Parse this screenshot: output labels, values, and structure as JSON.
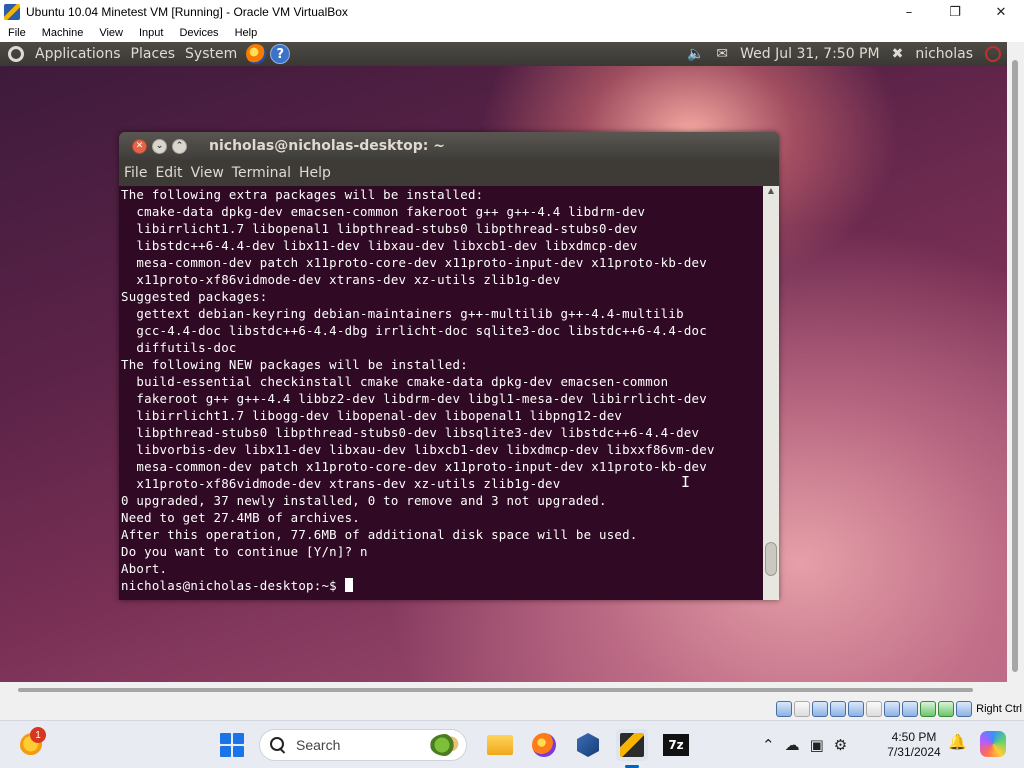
{
  "vbox": {
    "title": "Ubuntu 10.04 Minetest VM [Running] - Oracle VM VirtualBox",
    "menu": [
      "File",
      "Machine",
      "View",
      "Input",
      "Devices",
      "Help"
    ],
    "host_key": "Right Ctrl"
  },
  "ubuntu_panel": {
    "menus": [
      "Applications",
      "Places",
      "System"
    ],
    "datetime": "Wed Jul 31,  7:50 PM",
    "user": "nicholas"
  },
  "terminal": {
    "title": "nicholas@nicholas-desktop: ~",
    "menu": [
      "File",
      "Edit",
      "View",
      "Terminal",
      "Help"
    ],
    "lines": [
      "The following extra packages will be installed:",
      "  cmake-data dpkg-dev emacsen-common fakeroot g++ g++-4.4 libdrm-dev",
      "  libirrlicht1.7 libopenal1 libpthread-stubs0 libpthread-stubs0-dev",
      "  libstdc++6-4.4-dev libx11-dev libxau-dev libxcb1-dev libxdmcp-dev",
      "  mesa-common-dev patch x11proto-core-dev x11proto-input-dev x11proto-kb-dev",
      "  x11proto-xf86vidmode-dev xtrans-dev xz-utils zlib1g-dev",
      "Suggested packages:",
      "  gettext debian-keyring debian-maintainers g++-multilib g++-4.4-multilib",
      "  gcc-4.4-doc libstdc++6-4.4-dbg irrlicht-doc sqlite3-doc libstdc++6-4.4-doc",
      "  diffutils-doc",
      "The following NEW packages will be installed:",
      "  build-essential checkinstall cmake cmake-data dpkg-dev emacsen-common",
      "  fakeroot g++ g++-4.4 libbz2-dev libdrm-dev libgl1-mesa-dev libirrlicht-dev",
      "  libirrlicht1.7 libogg-dev libopenal-dev libopenal1 libpng12-dev",
      "  libpthread-stubs0 libpthread-stubs0-dev libsqlite3-dev libstdc++6-4.4-dev",
      "  libvorbis-dev libx11-dev libxau-dev libxcb1-dev libxdmcp-dev libxxf86vm-dev",
      "  mesa-common-dev patch x11proto-core-dev x11proto-input-dev x11proto-kb-dev",
      "  x11proto-xf86vidmode-dev xtrans-dev xz-utils zlib1g-dev",
      "0 upgraded, 37 newly installed, 0 to remove and 3 not upgraded.",
      "Need to get 27.4MB of archives.",
      "After this operation, 77.6MB of additional disk space will be used.",
      "Do you want to continue [Y/n]? n",
      "Abort."
    ],
    "prompt": "nicholas@nicholas-desktop:~$ "
  },
  "taskbar": {
    "weather_badge": "1",
    "search_placeholder": "Search",
    "app_7zip": "7z",
    "time": "4:50 PM",
    "date": "7/31/2024"
  }
}
